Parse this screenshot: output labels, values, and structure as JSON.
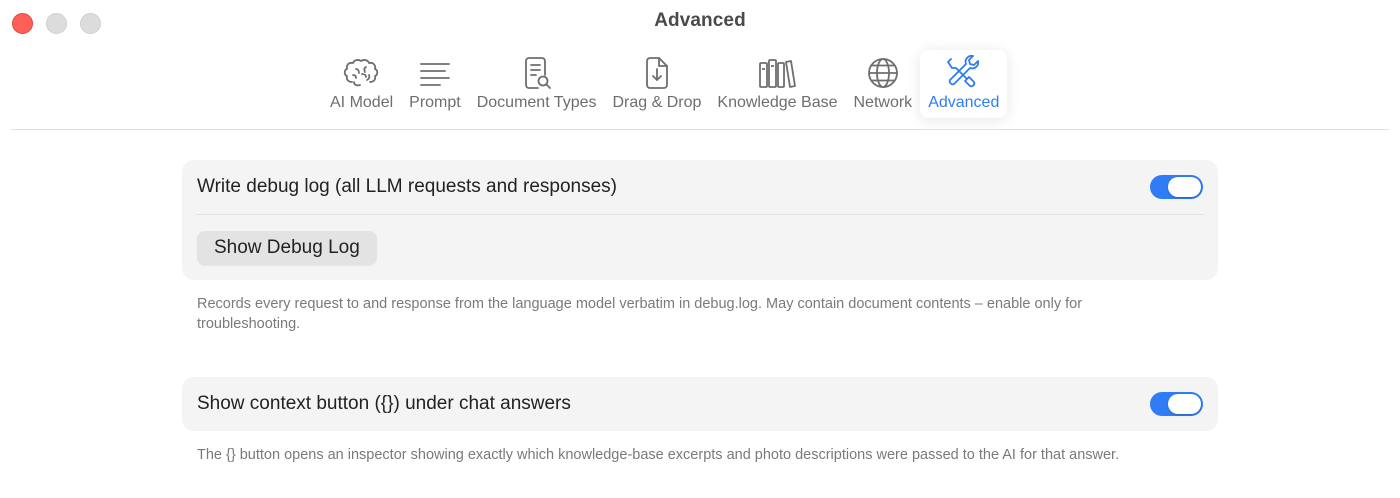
{
  "window": {
    "title": "Advanced"
  },
  "toolbar": {
    "tabs": [
      {
        "label": "AI Model",
        "icon": "brain-icon",
        "active": false
      },
      {
        "label": "Prompt",
        "icon": "lines-icon",
        "active": false
      },
      {
        "label": "Document Types",
        "icon": "document-search-icon",
        "active": false
      },
      {
        "label": "Drag & Drop",
        "icon": "document-download-icon",
        "active": false
      },
      {
        "label": "Knowledge Base",
        "icon": "books-icon",
        "active": false
      },
      {
        "label": "Network",
        "icon": "globe-icon",
        "active": false
      },
      {
        "label": "Advanced",
        "icon": "tools-icon",
        "active": true
      }
    ]
  },
  "settings": {
    "debug_log": {
      "label": "Write debug log (all LLM requests and responses)",
      "enabled": true,
      "button_label": "Show Debug Log",
      "help": "Records every request to and response from the language model verbatim in debug.log. May contain document contents – enable only for troubleshooting."
    },
    "context_button": {
      "label": "Show context button ({}) under chat answers",
      "enabled": true,
      "help": "The {} button opens an inspector showing exactly which knowledge-base excerpts and photo descriptions were passed to the AI for that answer."
    }
  },
  "colors": {
    "accent": "#2f7cf6",
    "close": "#ff5f57"
  }
}
